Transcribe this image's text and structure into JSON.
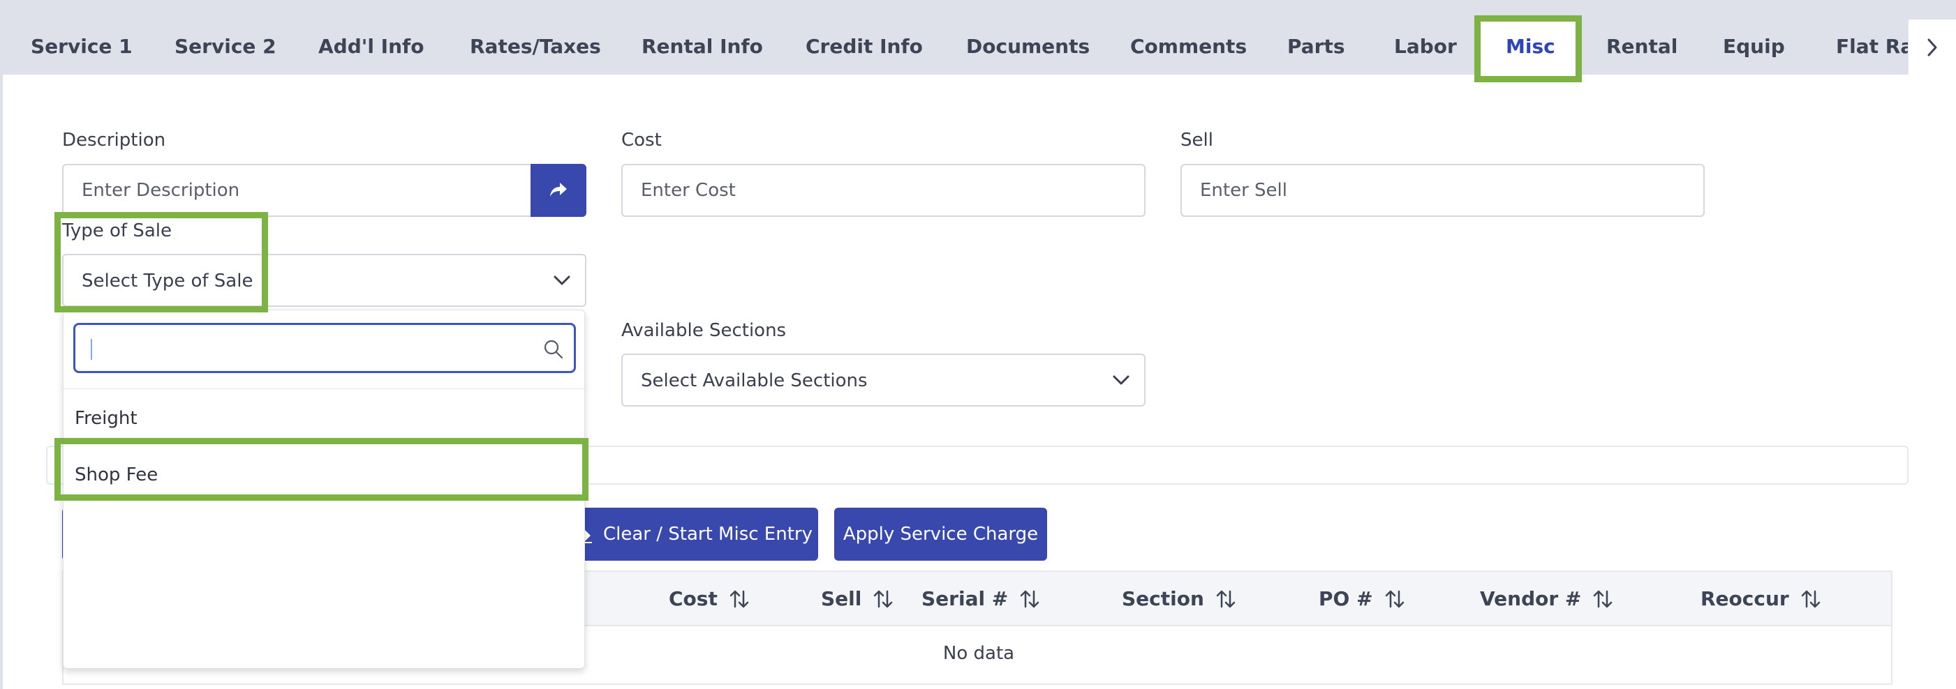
{
  "tabs": [
    {
      "label": "Service 1",
      "name": "tab-service-1"
    },
    {
      "label": "Service 2",
      "name": "tab-service-2"
    },
    {
      "label": "Add'l Info",
      "name": "tab-addl-info"
    },
    {
      "label": "Rates/Taxes",
      "name": "tab-rates-taxes"
    },
    {
      "label": "Rental Info",
      "name": "tab-rental-info"
    },
    {
      "label": "Credit Info",
      "name": "tab-credit-info"
    },
    {
      "label": "Documents",
      "name": "tab-documents"
    },
    {
      "label": "Comments",
      "name": "tab-comments"
    },
    {
      "label": "Parts",
      "name": "tab-parts"
    },
    {
      "label": "Labor",
      "name": "tab-labor"
    },
    {
      "label": "Misc",
      "name": "tab-misc",
      "active": true
    },
    {
      "label": "Rental",
      "name": "tab-rental"
    },
    {
      "label": "Equip",
      "name": "tab-equip"
    },
    {
      "label": "Flat Rat",
      "name": "tab-flat-rate"
    }
  ],
  "form": {
    "description_label": "Description",
    "description_placeholder": "Enter Description",
    "cost_label": "Cost",
    "cost_placeholder": "Enter Cost",
    "sell_label": "Sell",
    "sell_placeholder": "Enter Sell",
    "type_of_sale_label": "Type of Sale",
    "type_of_sale_placeholder": "Select Type of Sale",
    "available_sections_label": "Available Sections",
    "available_sections_placeholder": "Select Available Sections"
  },
  "dropdown": {
    "search_value": "",
    "options": [
      "Freight",
      "Shop Fee"
    ]
  },
  "buttons": {
    "clear_label": "Clear / Start Misc Entry",
    "apply_label": "Apply Service Charge"
  },
  "table": {
    "columns": [
      "Cost",
      "Sell",
      "Serial #",
      "Section",
      "PO #",
      "Vendor #",
      "Reoccur"
    ],
    "empty_text": "No data"
  },
  "colors": {
    "accent": "#3848ad",
    "active_tab_text": "#2e45b8",
    "highlight": "#7cb342"
  }
}
